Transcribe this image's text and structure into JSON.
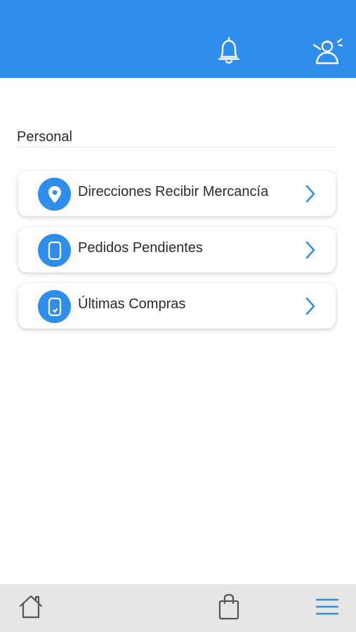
{
  "header": {
    "bell_icon": "bell-icon",
    "profile_icon": "user-icon"
  },
  "section": {
    "title": "Personal"
  },
  "menu": {
    "items": [
      {
        "label": "Direcciones Recibir Mercancía",
        "icon": "location-pin-icon"
      },
      {
        "label": "Pedidos Pendientes",
        "icon": "phone-icon"
      },
      {
        "label": "Últimas Compras",
        "icon": "phone-check-icon"
      }
    ]
  },
  "bottom_nav": {
    "items": [
      "home-icon",
      "shopping-bag-icon",
      "hamburger-menu-icon"
    ]
  },
  "colors": {
    "accent": "#2f8deb",
    "chevron": "#2f8deb",
    "nav_bg": "#e6e6e6",
    "text": "#2b2b2b"
  }
}
